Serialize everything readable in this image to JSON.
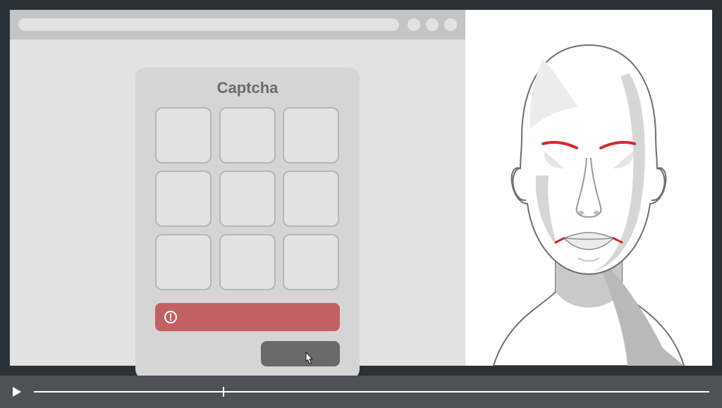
{
  "browser": {
    "url_placeholder": ""
  },
  "captcha": {
    "title": "Captcha",
    "grid_count": 9,
    "error_message": "",
    "submit_label": ""
  },
  "facial_expression": {
    "brow_angle": "furrowed-down",
    "mouth_corners": "downturned",
    "emotion": "frustrated",
    "highlight_color": "#d4272a"
  },
  "player": {
    "state": "paused",
    "progress_fraction": 0.28
  }
}
